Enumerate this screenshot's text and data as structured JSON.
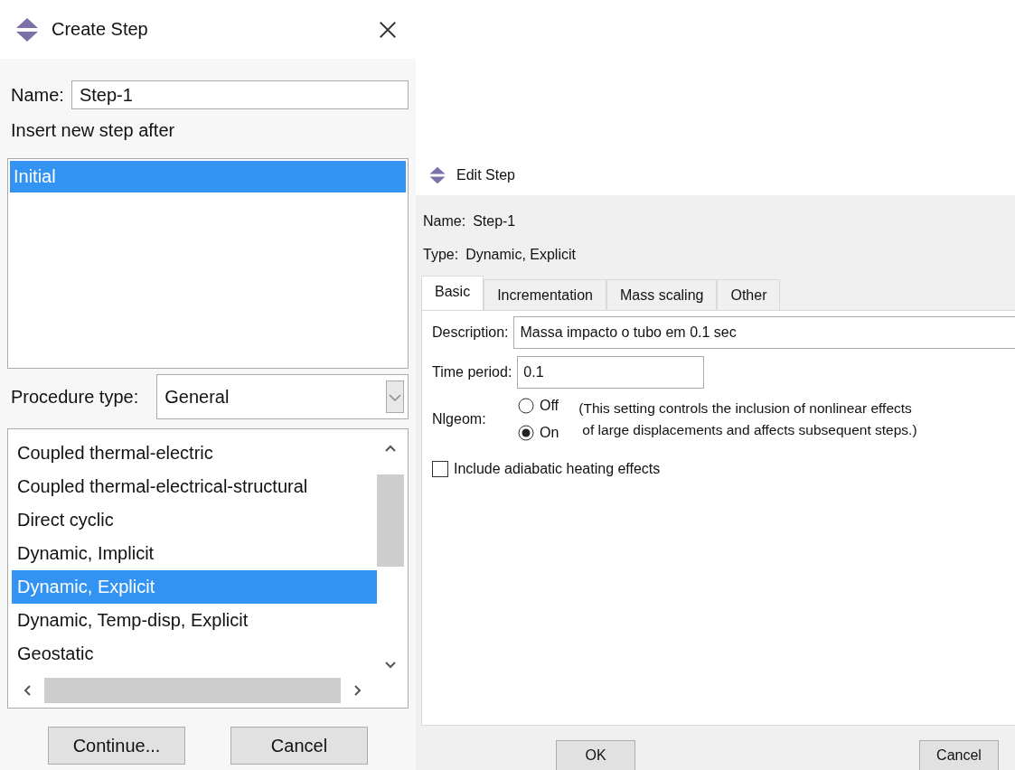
{
  "create_step": {
    "title": "Create Step",
    "name_label": "Name:",
    "name_value": "Step-1",
    "insert_label": "Insert new step after",
    "steps": [
      {
        "label": "Initial",
        "selected": true
      }
    ],
    "procedure_label": "Procedure type:",
    "procedure_value": "General",
    "procedures": [
      {
        "label": "Coupled thermal-electric",
        "selected": false
      },
      {
        "label": "Coupled thermal-electrical-structural",
        "selected": false
      },
      {
        "label": "Direct cyclic",
        "selected": false
      },
      {
        "label": "Dynamic, Implicit",
        "selected": false
      },
      {
        "label": "Dynamic, Explicit",
        "selected": true
      },
      {
        "label": "Dynamic, Temp-disp, Explicit",
        "selected": false
      },
      {
        "label": "Geostatic",
        "selected": false
      }
    ],
    "buttons": [
      "Continue...",
      "Cancel"
    ]
  },
  "edit_step": {
    "title": "Edit Step",
    "name_label": "Name:",
    "name_value": "Step-1",
    "type_label": "Type:",
    "type_value": "Dynamic, Explicit",
    "tabs": [
      {
        "label": "Basic",
        "selected": true
      },
      {
        "label": "Incrementation",
        "selected": false
      },
      {
        "label": "Mass scaling",
        "selected": false
      },
      {
        "label": "Other",
        "selected": false
      }
    ],
    "description_label": "Description:",
    "description_value": "Massa impacto o tubo em 0.1 sec",
    "time_period_label": "Time period:",
    "time_period_value": "0.1",
    "nlgeom_label": "Nlgeom:",
    "nlgeom_options": [
      {
        "label": "Off",
        "selected": false
      },
      {
        "label": "On",
        "selected": true
      }
    ],
    "nlgeom_note": [
      "(This setting controls the inclusion of nonlinear effects",
      "of large displacements and affects subsequent steps.)"
    ],
    "adiabatic": {
      "label": "Include adiabatic heating effects",
      "checked": false
    },
    "buttons": [
      "OK",
      "Cancel"
    ]
  }
}
